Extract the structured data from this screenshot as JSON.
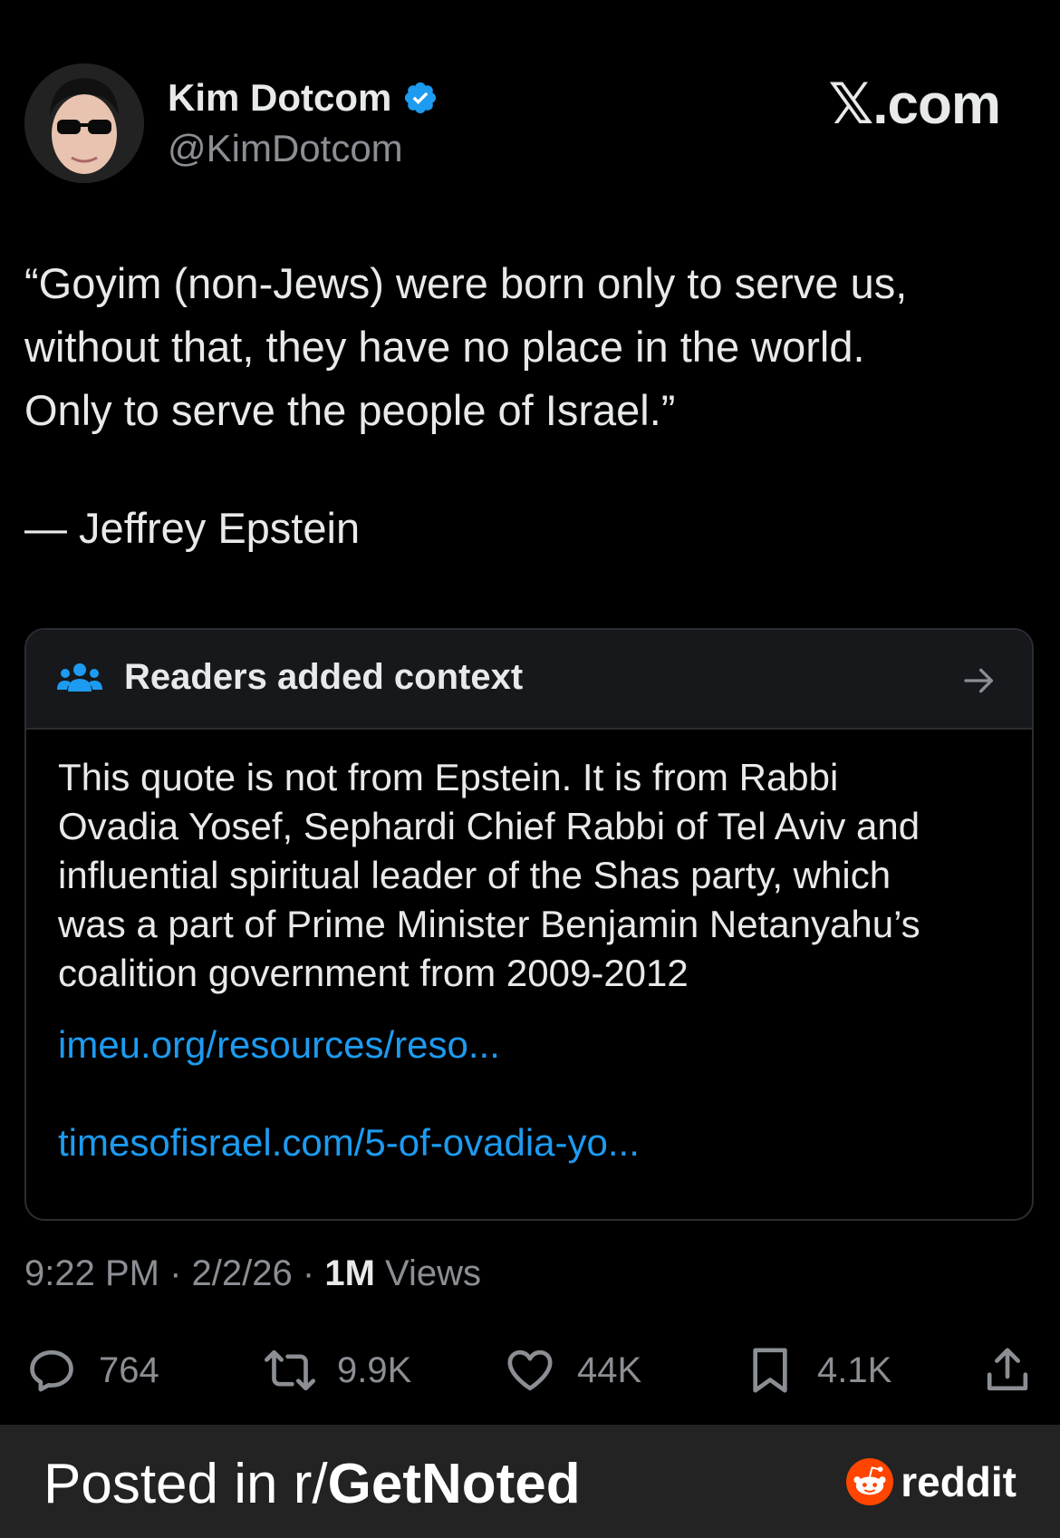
{
  "author": {
    "name": "Kim Dotcom",
    "handle": "@KimDotcom",
    "verified_color": "#1d9bf0"
  },
  "brand": "𝕏.com",
  "tweet": {
    "lines": [
      "“Goyim (non-Jews) were born only to serve us,",
      "without that, they have no place in the world.",
      "Only to serve the people of Israel.”"
    ],
    "attribution": "— Jeffrey Epstein"
  },
  "community_note": {
    "title": "Readers added context",
    "icon": "people-icon",
    "icon_color": "#1d9bf0",
    "body": [
      "This quote is not from Epstein. It is from Rabbi",
      "Ovadia Yosef, Sephardi Chief Rabbi of Tel Aviv and",
      "influential spiritual leader of the Shas party, which",
      "was a part of Prime Minister Benjamin Netanyahu’s",
      "coalition government from 2009-2012"
    ],
    "links": [
      "imeu.org/resources/reso...",
      "timesofisrael.com/5-of-ovadia-yo..."
    ],
    "link_color": "#1d9bf0"
  },
  "meta": {
    "time": "9:22 PM",
    "date": "2/2/26",
    "views_count": "1M",
    "views_label": "Views",
    "separator": "·"
  },
  "actions": {
    "replies": "764",
    "reposts": "9.9K",
    "likes": "44K",
    "bookmarks": "4.1K"
  },
  "footer": {
    "posted_prefix": "Posted in r/",
    "subreddit": "GetNoted",
    "reddit_label": "reddit",
    "reddit_color": "#ff4500"
  }
}
